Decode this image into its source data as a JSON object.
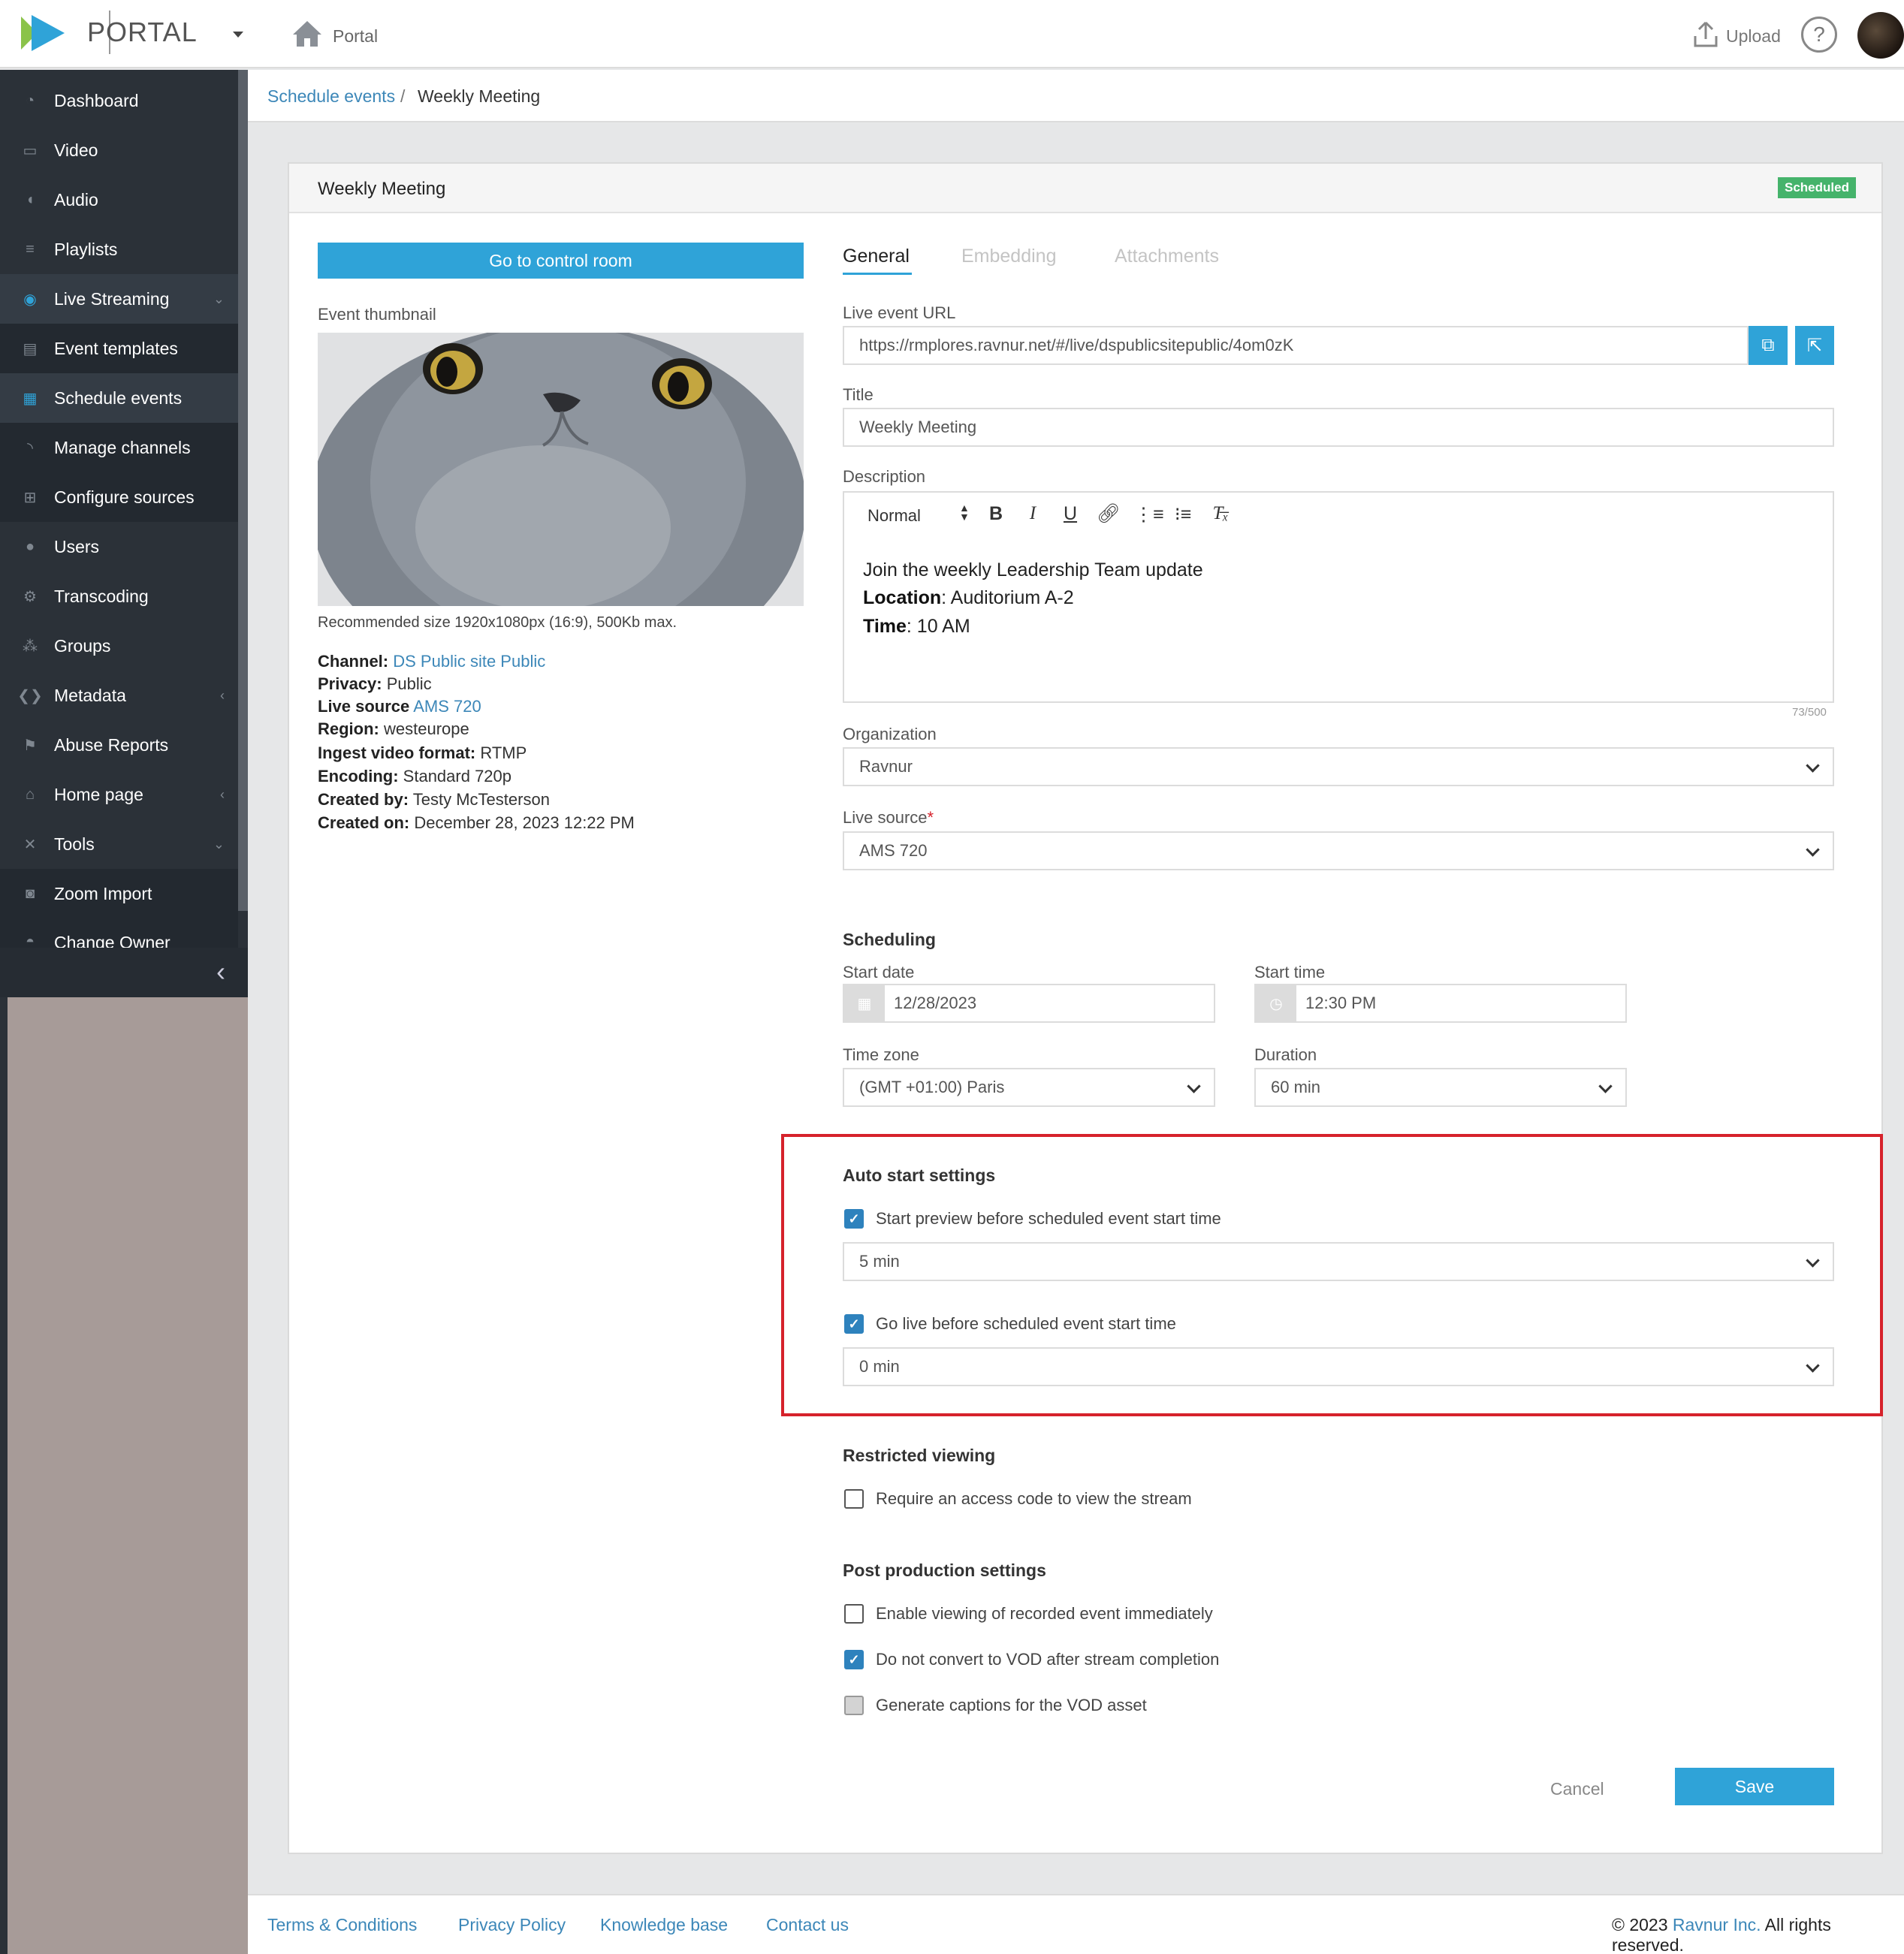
{
  "header": {
    "logo_text": "PORTAL",
    "home_label": "Portal",
    "upload_label": "Upload",
    "help_label": "?"
  },
  "sidebar": {
    "items": [
      {
        "label": "Dashboard",
        "icon": "dashboard-icon"
      },
      {
        "label": "Video",
        "icon": "video-icon"
      },
      {
        "label": "Audio",
        "icon": "audio-icon"
      },
      {
        "label": "Playlists",
        "icon": "list-icon"
      },
      {
        "label": "Live Streaming",
        "icon": "broadcast-icon"
      },
      {
        "label": "Event templates",
        "icon": "template-icon"
      },
      {
        "label": "Schedule events",
        "icon": "calendar-icon"
      },
      {
        "label": "Manage channels",
        "icon": "rss-icon"
      },
      {
        "label": "Configure sources",
        "icon": "sitemap-icon"
      },
      {
        "label": "Users",
        "icon": "user-icon"
      },
      {
        "label": "Transcoding",
        "icon": "cog-icon"
      },
      {
        "label": "Groups",
        "icon": "group-icon"
      },
      {
        "label": "Metadata",
        "icon": "code-icon"
      },
      {
        "label": "Abuse Reports",
        "icon": "flag-icon"
      },
      {
        "label": "Home page",
        "icon": "home-icon"
      },
      {
        "label": "Tools",
        "icon": "tools-icon"
      },
      {
        "label": "Zoom Import",
        "icon": "zoom-icon"
      },
      {
        "label": "Change Owner",
        "icon": "owner-icon"
      }
    ]
  },
  "breadcrumb": {
    "parent": "Schedule events",
    "separator": "/",
    "current": "Weekly Meeting"
  },
  "card": {
    "title": "Weekly Meeting",
    "status": "Scheduled"
  },
  "left": {
    "control_room_button": "Go to control room",
    "thumbnail_label": "Event thumbnail",
    "thumbnail_note": "Recommended size 1920x1080px (16:9), 500Kb max.",
    "meta": {
      "channel_label": "Channel:",
      "channel_value": "DS Public site Public",
      "privacy_label": "Privacy:",
      "privacy_value": "Public",
      "live_source_label": "Live source",
      "live_source_value": "AMS 720",
      "region_label": "Region:",
      "region_value": "westeurope",
      "ingest_label": "Ingest video format:",
      "ingest_value": "RTMP",
      "encoding_label": "Encoding:",
      "encoding_value": "Standard 720p",
      "created_by_label": "Created by:",
      "created_by_value": "Testy McTesterson",
      "created_on_label": "Created on:",
      "created_on_value": "December 28, 2023 12:22 PM"
    }
  },
  "tabs": {
    "general": "General",
    "embedding": "Embedding",
    "attachments": "Attachments"
  },
  "form": {
    "live_url_label": "Live event URL",
    "live_url_value": "https://rmplores.ravnur.net/#/live/dspublicsitepublic/4om0zK",
    "title_label": "Title",
    "title_value": "Weekly Meeting",
    "description_label": "Description",
    "editor_format": "Normal",
    "description_line1": "Join the weekly Leadership Team update",
    "description_location_label": "Location",
    "description_location_value": ": Auditorium A-2",
    "description_time_label": "Time",
    "description_time_value": ": 10 AM",
    "char_count": "73/500",
    "organization_label": "Organization",
    "organization_value": "Ravnur",
    "live_source_label": "Live source",
    "required_mark": "*",
    "live_source_value": "AMS 720",
    "scheduling_title": "Scheduling",
    "start_date_label": "Start date",
    "start_date_value": "12/28/2023",
    "start_time_label": "Start time",
    "start_time_value": "12:30 PM",
    "time_zone_label": "Time zone",
    "time_zone_value": "(GMT +01:00) Paris",
    "duration_label": "Duration",
    "duration_value": "60 min",
    "auto_start_title": "Auto start settings",
    "preview_label": "Start preview before scheduled event start time",
    "preview_checked": true,
    "preview_value": "5 min",
    "golive_label": "Go live before scheduled event start time",
    "golive_checked": true,
    "golive_value": "0 min",
    "restricted_title": "Restricted viewing",
    "access_code_label": "Require an access code to view the stream",
    "access_code_checked": false,
    "post_title": "Post production settings",
    "enable_viewing_label": "Enable viewing of recorded event immediately",
    "enable_viewing_checked": false,
    "no_vod_label": "Do not convert to VOD after stream completion",
    "no_vod_checked": true,
    "captions_label": "Generate captions for the VOD asset",
    "captions_checked": false,
    "cancel_label": "Cancel",
    "save_label": "Save"
  },
  "footer": {
    "terms": "Terms & Conditions",
    "privacy": "Privacy Policy",
    "knowledge": "Knowledge base",
    "contact": "Contact us",
    "copyright_prefix": "© 2023",
    "company": "Ravnur Inc.",
    "copyright_suffix": "All rights reserved."
  },
  "colors": {
    "accent": "#2fa3d8",
    "sidebar": "#2b3138",
    "status": "#45b36b",
    "highlight": "#d6222b"
  }
}
